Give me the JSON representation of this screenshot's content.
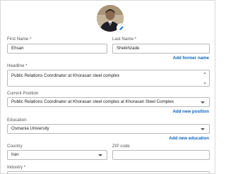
{
  "profile": {
    "avatar_alt": "profile photo"
  },
  "first_name": {
    "label": "First Name *",
    "value": "Ehsan"
  },
  "last_name": {
    "label": "Last Name *",
    "value": "Sheikhzade"
  },
  "add_former_name": "Add former name",
  "headline": {
    "label": "Headline *",
    "value": "Public Relations Coordinator at Khorasan steel complex"
  },
  "current_position": {
    "label": "Current Position",
    "value": "Public Relations Coordinator at Khorasan steel complex at Khorasan Steel Complex"
  },
  "add_new_position": "Add new position",
  "education": {
    "label": "Education",
    "value": "Osmania University"
  },
  "add_new_education": "Add new education",
  "country": {
    "label": "Country",
    "value": "Iran"
  },
  "zip_code": {
    "label": "ZIP code",
    "value": ""
  },
  "industry": {
    "label": "Industry *"
  },
  "colors": {
    "link": "#0a66c2",
    "border": "#b8b8b8"
  }
}
